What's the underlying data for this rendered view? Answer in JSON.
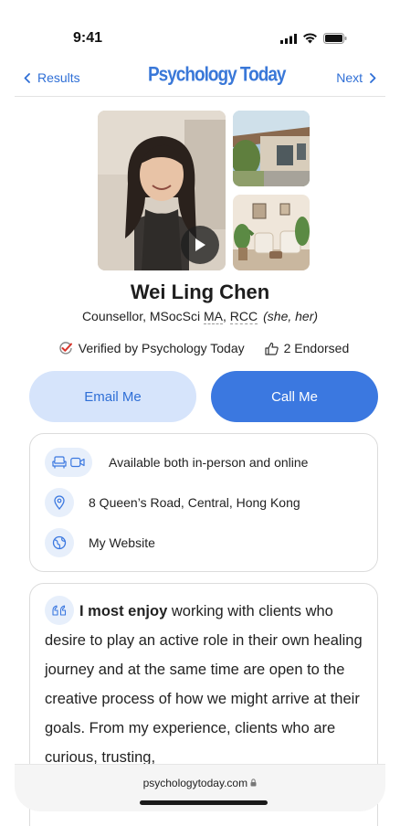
{
  "status": {
    "time": "9:41"
  },
  "nav": {
    "back_label": "Results",
    "brand": "Psychology Today",
    "next_label": "Next"
  },
  "profile": {
    "name": "Wei Ling Chen",
    "title_prefix": "Counsellor, MSocSci ",
    "cred_ma": "MA",
    "comma": ", ",
    "cred_rcc": "RCC",
    "pronouns": "(she, her)",
    "verified_label": "Verified by Psychology Today",
    "endorsed_label": "2 Endorsed"
  },
  "actions": {
    "email_label": "Email Me",
    "call_label": "Call Me"
  },
  "info": {
    "availability": "Available both in-person and online",
    "address": "8 Queen’s Road, Central, Hong Kong",
    "website": "My Website"
  },
  "about": {
    "lead": "I most enjoy",
    "text": " working with clients who desire to play an active role in their own healing journey and at the same time are open to the creative process of how we might arrive at their goals. From my experience, clients who are curious, trusting,"
  },
  "browser": {
    "url": "psychologytoday.com"
  },
  "colors": {
    "accent": "#3b78e0",
    "accent_light": "#d6e4fb",
    "icon_bg": "#e7effb",
    "verified_red": "#d9342b"
  },
  "icons": [
    "chevron-left-icon",
    "chevron-right-icon",
    "play-icon",
    "verified-check-icon",
    "thumbs-up-icon",
    "armchair-icon",
    "video-icon",
    "location-pin-icon",
    "globe-icon",
    "quote-icon",
    "lock-icon"
  ]
}
